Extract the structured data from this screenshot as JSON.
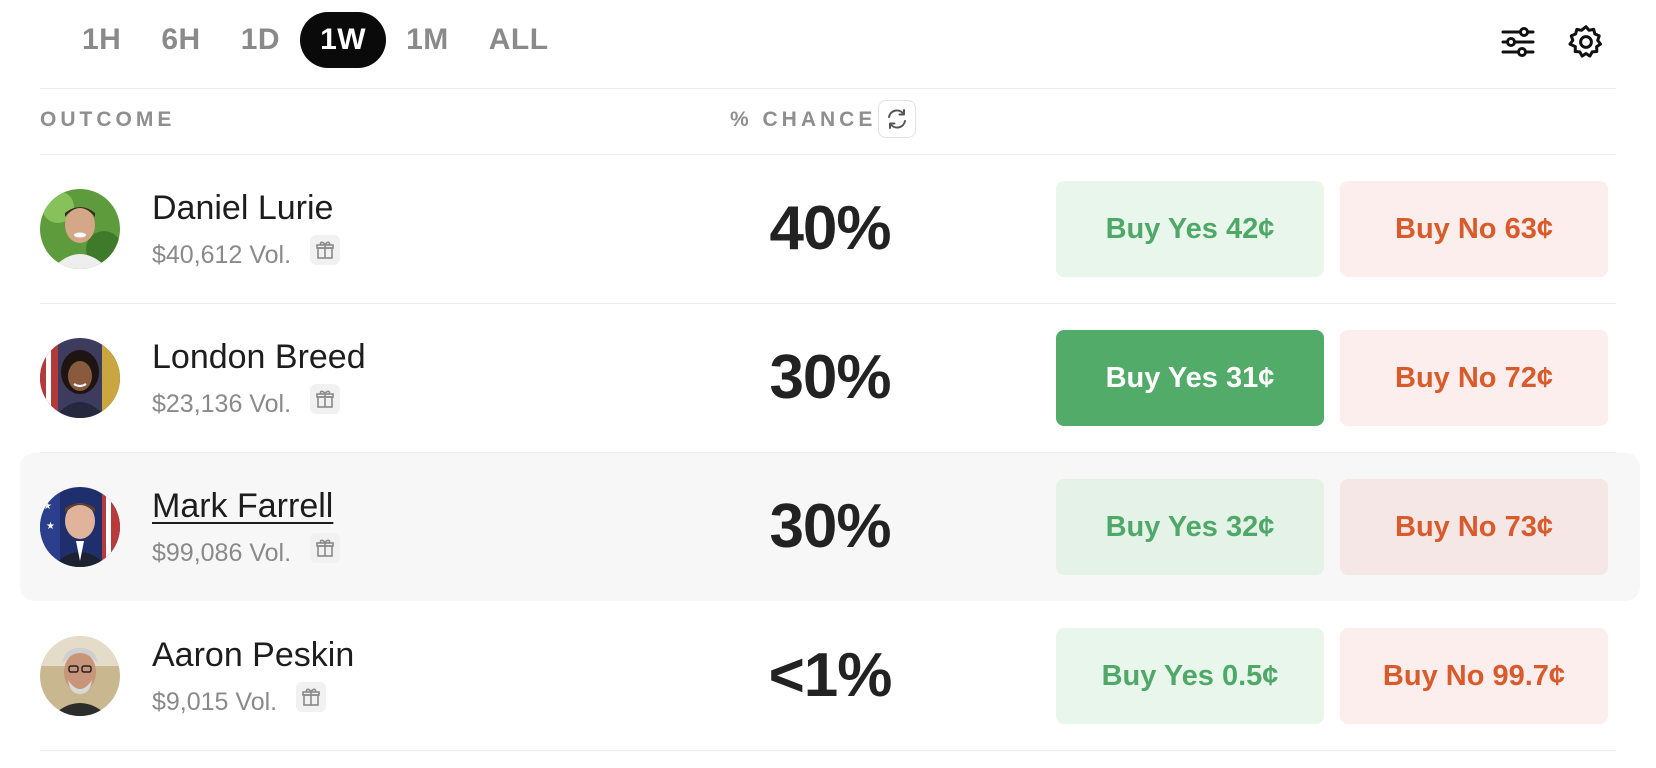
{
  "ranges": [
    "1H",
    "6H",
    "1D",
    "1W",
    "1M",
    "ALL"
  ],
  "active_range": "1W",
  "toolbar": {
    "filter_icon": "sliders-icon",
    "settings_icon": "gear-icon"
  },
  "table": {
    "col_outcome": "OUTCOME",
    "col_chance": "% CHANCE"
  },
  "rows": [
    {
      "name": "Daniel Lurie",
      "vol": "$40,612 Vol.",
      "pct": "40%",
      "yes": "Buy Yes 42¢",
      "no": "Buy No 63¢"
    },
    {
      "name": "London Breed",
      "vol": "$23,136 Vol.",
      "pct": "30%",
      "yes": "Buy Yes 31¢",
      "no": "Buy No 72¢"
    },
    {
      "name": "Mark Farrell",
      "vol": "$99,086 Vol.",
      "pct": "30%",
      "yes": "Buy Yes 32¢",
      "no": "Buy No 73¢"
    },
    {
      "name": "Aaron Peskin",
      "vol": "$9,015 Vol.",
      "pct": "<1%",
      "yes": "Buy Yes 0.5¢",
      "no": "Buy No 99.7¢"
    }
  ],
  "colors": {
    "yes": "#4fa868",
    "yes_solid": "#52ab69",
    "no": "#d95a2b",
    "active_pill": "#0a0a0a"
  }
}
